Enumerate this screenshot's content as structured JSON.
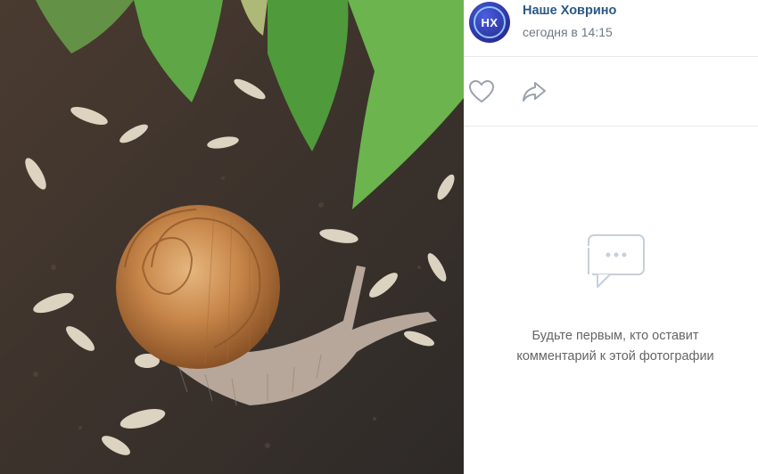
{
  "post": {
    "group_name": "Наше Ховрино",
    "avatar_text": "НХ",
    "time": "сегодня в 14:15"
  },
  "actions": {
    "like_icon": "heart-icon",
    "share_icon": "share-arrow-icon"
  },
  "comments": {
    "empty_icon": "comments-bubble-icon",
    "empty_line_1": "Будьте первым, кто оставит",
    "empty_line_2": "комментарий к этой фотографии"
  },
  "colors": {
    "link": "#2a5885",
    "secondary": "#6f7985",
    "icon_gray": "#99a2ad",
    "divider": "#e7e8ec"
  }
}
